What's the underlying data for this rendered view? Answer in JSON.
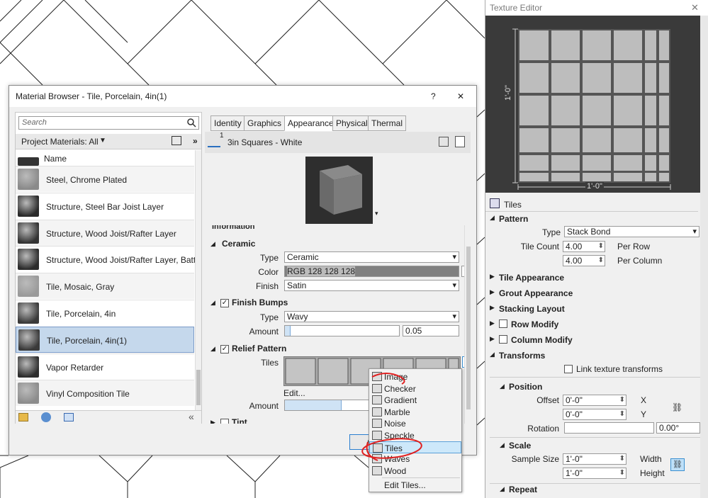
{
  "material_browser": {
    "title": "Material Browser - Tile, Porcelain, 4in(1)",
    "help": "?",
    "close": "✕",
    "search_placeholder": "Search",
    "filter_label": "Project Materials: All",
    "column_header": "Name",
    "materials": [
      {
        "name": "Steel, Chrome Plated"
      },
      {
        "name": "Structure, Steel Bar Joist Layer"
      },
      {
        "name": "Structure, Wood Joist/Rafter Layer"
      },
      {
        "name": "Structure, Wood Joist/Rafter Layer, Batt Insu"
      },
      {
        "name": "Tile, Mosaic, Gray"
      },
      {
        "name": "Tile, Porcelain, 4in"
      },
      {
        "name": "Tile, Porcelain, 4in(1)"
      },
      {
        "name": "Vapor Retarder"
      },
      {
        "name": "Vinyl Composition Tile"
      }
    ],
    "selected_material": "Tile, Porcelain, 4in(1)",
    "tabs": [
      "Identity",
      "Graphics",
      "Appearance",
      "Physical",
      "Thermal"
    ],
    "active_tab": "Appearance",
    "asset_count": "1",
    "asset_name": "3in Squares - White",
    "sections": {
      "information": "Information",
      "ceramic": {
        "title": "Ceramic",
        "type_label": "Type",
        "type_value": "Ceramic",
        "color_label": "Color",
        "color_value": "RGB 128 128 128",
        "finish_label": "Finish",
        "finish_value": "Satin"
      },
      "finish_bumps": {
        "title": "Finish Bumps",
        "type_label": "Type",
        "type_value": "Wavy",
        "amount_label": "Amount",
        "amount_value": "0.05",
        "amount_fraction": 0.05
      },
      "relief_pattern": {
        "title": "Relief Pattern",
        "tiles_label": "Tiles",
        "edit_label": "Edit...",
        "amount_label": "Amount",
        "amount_fraction": 0.45
      },
      "tint": "Tint"
    },
    "ok_label": "O"
  },
  "context_menu": {
    "items": [
      {
        "label": "Image",
        "icon": "image-icon"
      },
      {
        "label": "Checker",
        "icon": "checker-icon"
      },
      {
        "label": "Gradient",
        "icon": "gradient-icon"
      },
      {
        "label": "Marble",
        "icon": "marble-icon"
      },
      {
        "label": "Noise",
        "icon": "noise-icon"
      },
      {
        "label": "Speckle",
        "icon": "speckle-icon"
      },
      {
        "label": "Tiles",
        "icon": "tiles-icon"
      },
      {
        "label": "Waves",
        "icon": "waves-icon"
      },
      {
        "label": "Wood",
        "icon": "wood-icon"
      }
    ],
    "edit_tiles": "Edit Tiles...",
    "highlighted": "Tiles"
  },
  "texture_editor": {
    "title": "Texture Editor",
    "close": "✕",
    "dim_vertical": "1'-0\"",
    "dim_horizontal": "1'-0\"",
    "header": "Tiles",
    "pattern": {
      "title": "Pattern",
      "type_label": "Type",
      "type_value": "Stack Bond",
      "tile_count_label": "Tile Count",
      "per_row_value": "4.00",
      "per_row_label": "Per Row",
      "per_column_value": "4.00",
      "per_column_label": "Per Column"
    },
    "tile_appearance": "Tile Appearance",
    "grout_appearance": "Grout Appearance",
    "stacking_layout": "Stacking Layout",
    "row_modify": "Row Modify",
    "column_modify": "Column Modify",
    "transforms": {
      "title": "Transforms",
      "link_label": "Link texture transforms"
    },
    "position": {
      "title": "Position",
      "offset_label": "Offset",
      "offset_x": "0'-0\"",
      "x_label": "X",
      "offset_y": "0'-0\"",
      "y_label": "Y",
      "rotation_label": "Rotation",
      "rotation_value": "0.00°"
    },
    "scale": {
      "title": "Scale",
      "sample_size_label": "Sample Size",
      "width_value": "1'-0\"",
      "width_label": "Width",
      "height_value": "1'-0\"",
      "height_label": "Height"
    },
    "repeat": "Repeat"
  },
  "colors": {
    "selection": "#c5d8ec",
    "menu_highlight": "#cde8fa",
    "annotation_red": "#e02020",
    "preview_bg": "#3a3a3a",
    "tile_fill": "#bdbdbd"
  }
}
